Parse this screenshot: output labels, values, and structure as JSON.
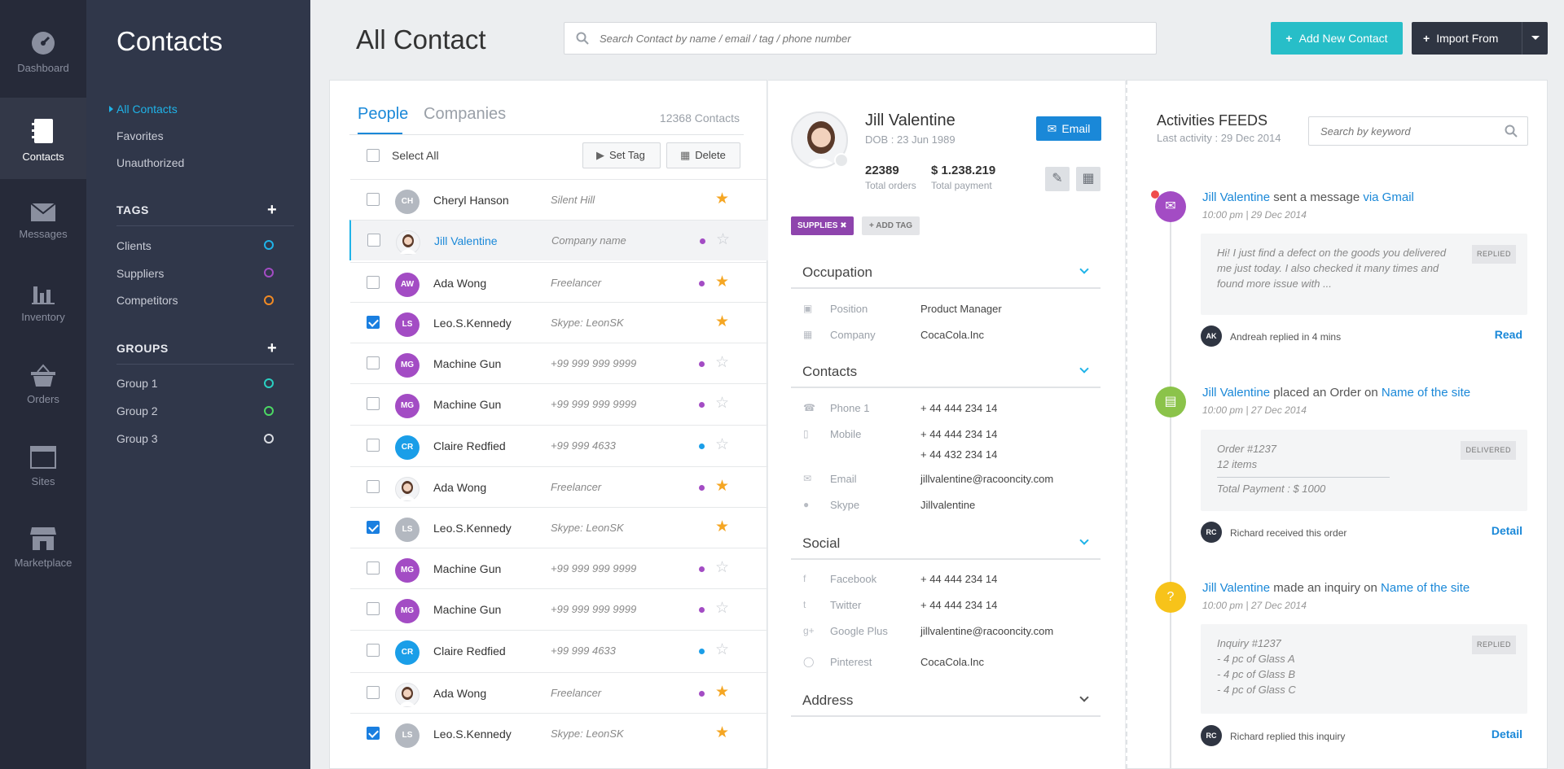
{
  "rail": [
    {
      "label": "Dashboard",
      "icon": "dashboard-icon"
    },
    {
      "label": "Contacts",
      "icon": "contacts-icon",
      "active": true
    },
    {
      "label": "Messages",
      "icon": "messages-icon"
    },
    {
      "label": "Inventory",
      "icon": "inventory-icon"
    },
    {
      "label": "Orders",
      "icon": "orders-icon"
    },
    {
      "label": "Sites",
      "icon": "sites-icon"
    },
    {
      "label": "Marketplace",
      "icon": "marketplace-icon"
    }
  ],
  "sidebar": {
    "title": "Contacts",
    "links": [
      "All Contacts",
      "Favorites",
      "Unauthorized"
    ],
    "tags_heading": "TAGS",
    "tags": [
      {
        "label": "Clients",
        "color": "#1fb3e8"
      },
      {
        "label": "Suppliers",
        "color": "#a34cc4"
      },
      {
        "label": "Competitors",
        "color": "#f08a24"
      }
    ],
    "groups_heading": "GROUPS",
    "groups": [
      {
        "label": "Group 1",
        "color": "#2ad0c2"
      },
      {
        "label": "Group 2",
        "color": "#4cd964"
      },
      {
        "label": "Group 3",
        "color": "#d9dce2"
      }
    ]
  },
  "header": {
    "title": "All Contact",
    "search_placeholder": "Search Contact by name / email / tag / phone number",
    "add_label": "Add New Contact",
    "import_label": "Import From"
  },
  "list": {
    "tab_people": "People",
    "tab_companies": "Companies",
    "count": "12368 Contacts",
    "select_all": "Select All",
    "set_tag": "Set Tag",
    "delete": "Delete",
    "rows": [
      {
        "initials": "CH",
        "name": "Cheryl Hanson",
        "info": "Silent Hill",
        "avatar": "#b3b8c0",
        "dot": "",
        "star": true,
        "checked": false
      },
      {
        "initials": "",
        "name": "Jill Valentine",
        "info": "Company name",
        "avatar": "photo",
        "dot": "#a34cc4",
        "star": false,
        "checked": false,
        "selected": true
      },
      {
        "initials": "AW",
        "name": "Ada Wong",
        "info": "Freelancer",
        "avatar": "#a34cc4",
        "dot": "#a34cc4",
        "star": true,
        "checked": false
      },
      {
        "initials": "LS",
        "name": "Leo.S.Kennedy",
        "info": "Skype: LeonSK",
        "avatar": "#a34cc4",
        "dot": "",
        "star": true,
        "checked": true
      },
      {
        "initials": "MG",
        "name": "Machine Gun",
        "info": "+99 999 999 9999",
        "avatar": "#a34cc4",
        "dot": "#a34cc4",
        "star": false,
        "checked": false
      },
      {
        "initials": "MG",
        "name": "Machine Gun",
        "info": "+99 999 999 9999",
        "avatar": "#a34cc4",
        "dot": "#a34cc4",
        "star": false,
        "checked": false
      },
      {
        "initials": "CR",
        "name": "Claire Redfied",
        "info": "+99 999 4633",
        "avatar": "#1a9ee8",
        "dot": "#1a9ee8",
        "star": false,
        "checked": false
      },
      {
        "initials": "",
        "name": "Ada Wong",
        "info": "Freelancer",
        "avatar": "photo",
        "dot": "#a34cc4",
        "star": true,
        "checked": false
      },
      {
        "initials": "LS",
        "name": "Leo.S.Kennedy",
        "info": "Skype: LeonSK",
        "avatar": "#b3b8c0",
        "dot": "",
        "star": true,
        "checked": true
      },
      {
        "initials": "MG",
        "name": "Machine Gun",
        "info": "+99 999 999 9999",
        "avatar": "#a34cc4",
        "dot": "#a34cc4",
        "star": false,
        "checked": false
      },
      {
        "initials": "MG",
        "name": "Machine Gun",
        "info": "+99 999 999 9999",
        "avatar": "#a34cc4",
        "dot": "#a34cc4",
        "star": false,
        "checked": false
      },
      {
        "initials": "CR",
        "name": "Claire Redfied",
        "info": "+99 999 4633",
        "avatar": "#1a9ee8",
        "dot": "#1a9ee8",
        "star": false,
        "checked": false
      },
      {
        "initials": "",
        "name": "Ada Wong",
        "info": "Freelancer",
        "avatar": "photo",
        "dot": "#a34cc4",
        "star": true,
        "checked": false
      },
      {
        "initials": "LS",
        "name": "Leo.S.Kennedy",
        "info": "Skype: LeonSK",
        "avatar": "#b3b8c0",
        "dot": "",
        "star": true,
        "checked": true
      }
    ]
  },
  "detail": {
    "name": "Jill Valentine",
    "dob": "DOB : 23 Jun 1989",
    "email_btn": "Email",
    "orders_value": "22389",
    "orders_label": "Total orders",
    "payment_value": "$ 1.238.219",
    "payment_label": "Total payment",
    "tag": "SUPPLIES",
    "add_tag": "ADD TAG",
    "occupation": "Occupation",
    "position_label": "Position",
    "position": "Product Manager",
    "company_label": "Company",
    "company": "CocaCola.Inc",
    "contacts": "Contacts",
    "phone_label": "Phone 1",
    "phone": "+ 44 444 234 14",
    "mobile_label": "Mobile",
    "mobile1": "+ 44 444 234 14",
    "mobile2": "+ 44 432 234 14",
    "email_label": "Email",
    "email": "jillvalentine@racooncity.com",
    "skype_label": "Skype",
    "skype": "Jillvalentine",
    "social": "Social",
    "facebook_label": "Facebook",
    "facebook": "+ 44 444 234 14",
    "twitter_label": "Twitter",
    "twitter": "+ 44 444 234 14",
    "gplus_label": "Google Plus",
    "gplus": "jillvalentine@racooncity.com",
    "pinterest_label": "Pinterest",
    "pinterest": "CocaCola.Inc",
    "address": "Address"
  },
  "feed": {
    "title": "Activities FEEDS",
    "last": "Last activity :  29 Dec 2014",
    "search_placeholder": "Search by keyword",
    "items": [
      {
        "actor": "Jill Valentine",
        "verb": " sent a message ",
        "target": "via Gmail",
        "time": "10:00 pm  |  29 Dec 2014",
        "body": "Hi! I just find a defect on the goods you delivered me just today. I also checked it many times and found more issue with  ...",
        "badge": "REPLIED",
        "by_initials": "AK",
        "by": "Andreah replied in 4 mins",
        "link": "Read",
        "color": "#a34cc4"
      },
      {
        "actor": "Jill Valentine",
        "verb": " placed an Order on ",
        "target": "Name of the site",
        "time": "10:00 pm  |  27 Dec 2014",
        "order": "Order #1237",
        "items_count": "12 items",
        "total": "Total Payment : $ 1000",
        "badge": "DELIVERED",
        "by_initials": "RC",
        "by": "Richard received this order",
        "link": "Detail",
        "color": "#8bc34a"
      },
      {
        "actor": "Jill Valentine",
        "verb": " made an inquiry on ",
        "target": "Name of the site",
        "time": "10:00 pm  |  27 Dec 2014",
        "inquiry": "Inquiry #1237",
        "l1": " - 4 pc of Glass A",
        "l2": "- 4 pc of Glass B",
        "l3": "- 4 pc of Glass C",
        "badge": "REPLIED",
        "by_initials": "RC",
        "by": "Richard replied this inquiry",
        "link": "Detail",
        "color": "#f7c31a"
      }
    ]
  }
}
